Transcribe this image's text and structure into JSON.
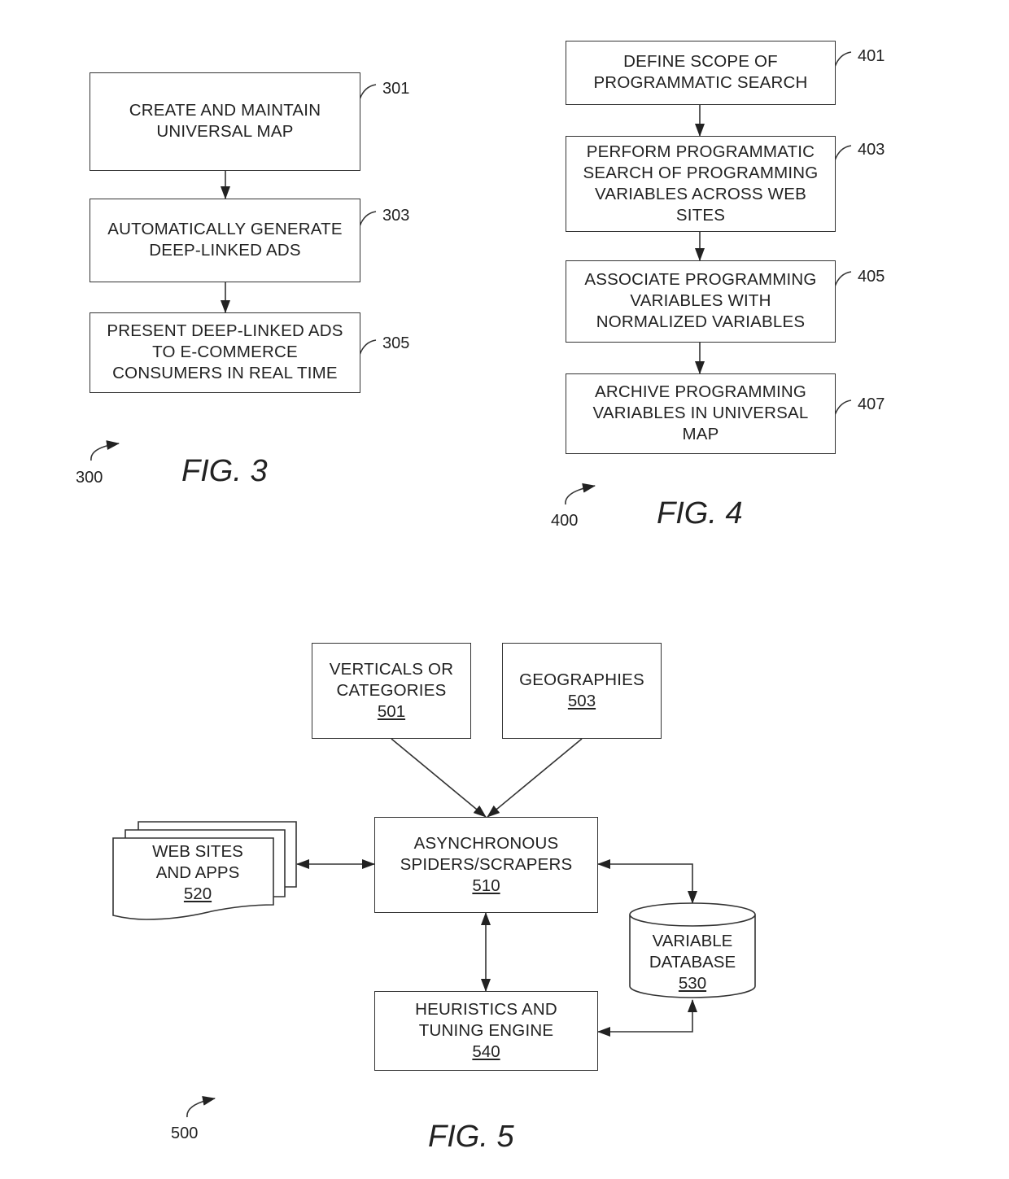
{
  "fig3": {
    "caption": "FIG. 3",
    "figure_ref": "300",
    "steps": [
      {
        "ref": "301",
        "text": "CREATE AND MAINTAIN\nUNIVERSAL MAP"
      },
      {
        "ref": "303",
        "text": "AUTOMATICALLY GENERATE\nDEEP-LINKED ADS"
      },
      {
        "ref": "305",
        "text": "PRESENT DEEP-LINKED ADS\nTO E-COMMERCE\nCONSUMERS IN REAL TIME"
      }
    ]
  },
  "fig4": {
    "caption": "FIG. 4",
    "figure_ref": "400",
    "steps": [
      {
        "ref": "401",
        "text": "DEFINE SCOPE OF\nPROGRAMMATIC SEARCH"
      },
      {
        "ref": "403",
        "text": "PERFORM PROGRAMMATIC\nSEARCH OF PROGRAMMING\nVARIABLES ACROSS WEB\nSITES"
      },
      {
        "ref": "405",
        "text": "ASSOCIATE PROGRAMMING\nVARIABLES WITH\nNORMALIZED VARIABLES"
      },
      {
        "ref": "407",
        "text": "ARCHIVE PROGRAMMING\nVARIABLES IN UNIVERSAL\nMAP"
      }
    ]
  },
  "fig5": {
    "caption": "FIG. 5",
    "figure_ref": "500",
    "nodes": {
      "verticals": {
        "text": "VERTICALS OR\nCATEGORIES",
        "num": "501"
      },
      "geographies": {
        "text": "GEOGRAPHIES",
        "num": "503"
      },
      "spiders": {
        "text": "ASYNCHRONOUS\nSPIDERS/SCRAPERS",
        "num": "510"
      },
      "websites": {
        "text": "WEB SITES\nAND APPS",
        "num": "520"
      },
      "database": {
        "text": "VARIABLE\nDATABASE",
        "num": "530"
      },
      "heuristics": {
        "text": "HEURISTICS AND\nTUNING ENGINE",
        "num": "540"
      }
    }
  }
}
